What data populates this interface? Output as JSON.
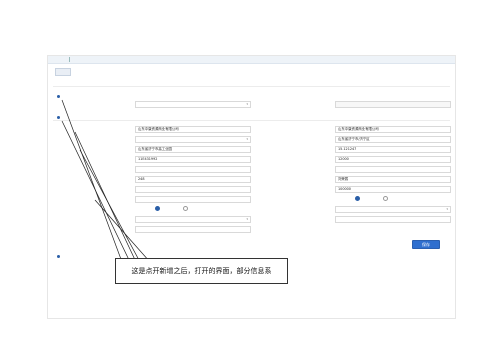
{
  "tabs": [
    {
      "label": ""
    },
    {
      "label": ""
    }
  ],
  "help_link": "",
  "back_button": "",
  "form_title": "",
  "section1": {
    "title": "",
    "fields": [
      {
        "label": "",
        "value": "",
        "type": "select"
      },
      {
        "label": "",
        "value": "",
        "type": "text",
        "readonly": true
      }
    ]
  },
  "section2": {
    "title": "",
    "left_fields": [
      {
        "label": "",
        "value": "山东中康资源商业有限公司"
      },
      {
        "label": "",
        "value": "",
        "type": "select"
      },
      {
        "label": "",
        "value": "山东省济宁市高工业园"
      },
      {
        "label": "",
        "value": "11E431992"
      },
      {
        "label": "",
        "value": "",
        "unit": ""
      },
      {
        "label": "",
        "value": "248",
        "unit": ""
      },
      {
        "label": "",
        "value": ""
      },
      {
        "label": "",
        "value": ""
      },
      {
        "label": "",
        "value": "",
        "radio": true,
        "options": [
          "",
          ""
        ]
      },
      {
        "label": "",
        "value": "",
        "type": "select"
      },
      {
        "label": "",
        "value": "",
        "type": "text"
      }
    ],
    "right_fields": [
      {
        "label": "",
        "value": "山东中康资源商业有限公司"
      },
      {
        "label": "",
        "value": "山东省济宁市/济宁区"
      },
      {
        "label": "",
        "value": "15.121247"
      },
      {
        "label": "",
        "value": "12000",
        "unit": ""
      },
      {
        "label": "",
        "value": ""
      },
      {
        "label": "",
        "value": "刘荣赛"
      },
      {
        "label": "",
        "value": "100000",
        "unit": ""
      },
      {
        "label": "",
        "value": "",
        "radio": true,
        "options": [
          "",
          ""
        ]
      },
      {
        "label": "",
        "value": "",
        "type": "select"
      },
      {
        "label": "",
        "value": ""
      }
    ]
  },
  "save_button": "保存",
  "section3": {
    "title": "",
    "subtitle": ""
  },
  "callout_text": "这是点开新增之后，打开的界面，部分信息系"
}
